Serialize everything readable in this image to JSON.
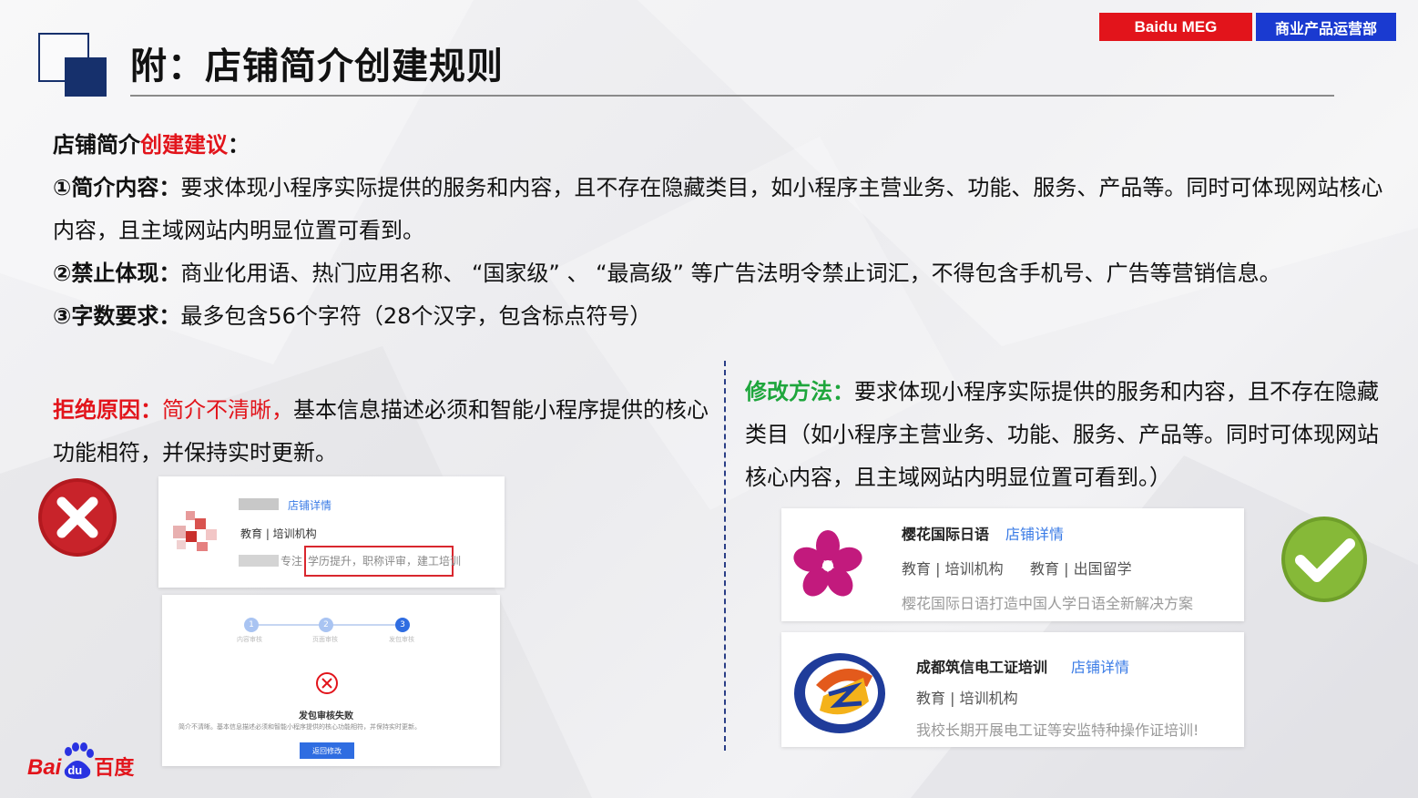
{
  "header": {
    "tag_meg": "Baidu MEG",
    "tag_dept": "商业产品运营部",
    "title": "附：店铺简介创建规则"
  },
  "suggestions": {
    "heading_prefix": "店铺简介",
    "heading_red": "创建建议",
    "heading_suffix": "：",
    "item1_label": "①简介内容：",
    "item1_text": "要求体现小程序实际提供的服务和内容，且不存在隐藏类目，如小程序主营业务、功能、服务、产品等。同时可体现网站核心内容，且主域网站内明显位置可看到。",
    "item2_label": "②禁止体现：",
    "item2_text": "商业化用语、热门应用名称、 “国家级” 、 “最高级” 等广告法明令禁止词汇，不得包含手机号、广告等营销信息。",
    "item3_label": "③字数要求：",
    "item3_text": "最多包含56个字符（28个汉字，包含标点符号）"
  },
  "reject": {
    "label": "拒绝原因：",
    "reason": "简介不清晰，",
    "text": "基本信息描述必须和智能小程序提供的核心功能相符，并保持实时更新。",
    "sample": {
      "link": "店铺详情",
      "category": "教育 | 培训机构",
      "desc_prefix": "专注",
      "desc_highlight": "学历提升，职称评审，建工培训",
      "steps": [
        "1",
        "2",
        "3"
      ],
      "step_labels": [
        "内容审核",
        "页面审核",
        "发包审核"
      ],
      "fail_title": "发包审核失败",
      "fail_text": "简介不清晰。基本信息描述必须和智能小程序提供的核心功能相符，并保持实时更新。",
      "return_button": "返回修改"
    }
  },
  "fix": {
    "label": "修改方法：",
    "text": "要求体现小程序实际提供的服务和内容，且不存在隐藏类目（如小程序主营业务、功能、服务、产品等。同时可体现网站　核心内容，且主域网站内明显位置可看到。）"
  },
  "good_samples": [
    {
      "name": "樱花国际日语",
      "link": "店铺详情",
      "cat1": "教育 | 培训机构",
      "cat2": "教育 | 出国留学",
      "desc": "樱花国际日语打造中国人学日语全新解决方案"
    },
    {
      "name": "成都筑信电工证培训",
      "link": "店铺详情",
      "cat1": "教育 | 培训机构",
      "desc": "我校长期开展电工证等安监特种操作证培训!"
    }
  ],
  "footer": {
    "logo_left": "Bai",
    "logo_paw": "du",
    "logo_right": "百度"
  },
  "colors": {
    "accent_red": "#e2141b",
    "accent_blue": "#1a3ad0",
    "accent_green": "#1ea63c",
    "navy": "#16306c"
  }
}
